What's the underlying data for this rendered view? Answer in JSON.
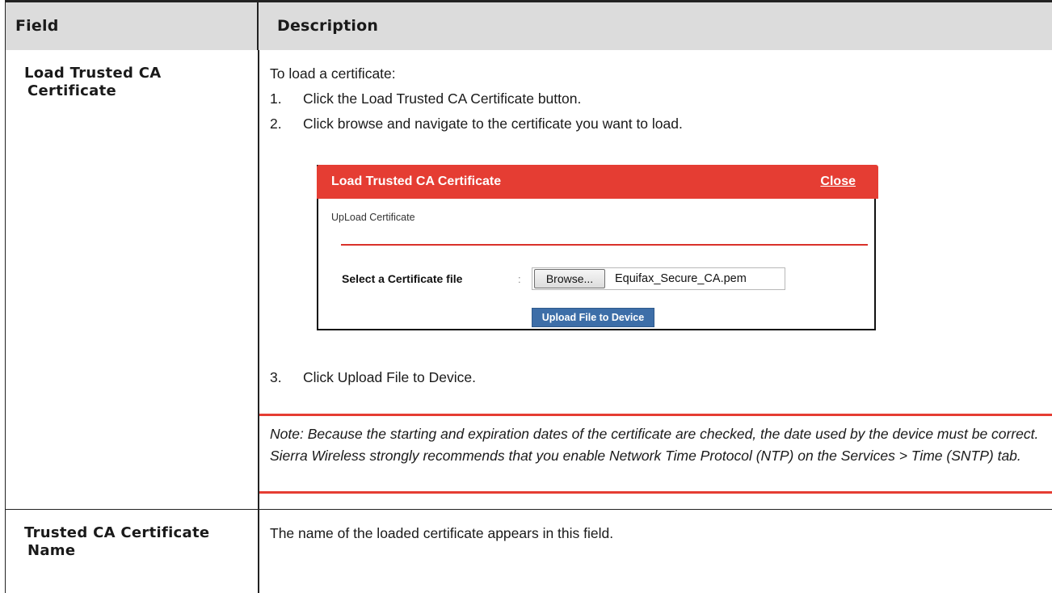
{
  "table": {
    "headers": {
      "field": "Field",
      "description": "Description"
    },
    "rows": [
      {
        "field_line1": "Load Trusted CA",
        "field_line2": "Certificate",
        "intro": "To load a certificate:",
        "steps": [
          {
            "num": "1.",
            "text": "Click the Load Trusted CA Certificate button."
          },
          {
            "num": "2.",
            "text": "Click browse and navigate to the certificate you want to load."
          },
          {
            "num": "3.",
            "text": "Click Upload File to Device."
          }
        ],
        "dialog": {
          "title": "Load Trusted CA Certificate",
          "close_label": "Close",
          "section_title": "UpLoad Certificate",
          "file_label": "Select a Certificate file",
          "colon": ":",
          "browse_label": "Browse...",
          "file_name": "Equifax_Secure_CA.pem",
          "upload_label": "Upload File to Device"
        },
        "note": "Note:  Because the starting and expiration dates of the certificate are checked, the date used by the device must be correct. Sierra Wireless strongly recommends that you enable Network Time Protocol (NTP) on the Services > Time (SNTP) tab."
      },
      {
        "field_line1": "Trusted CA Certificate",
        "field_line2": "Name",
        "description": "The name of the loaded certificate appears in this field."
      }
    ]
  },
  "colors": {
    "accent_red": "#e53d33",
    "upload_button_blue": "#3d6ea8",
    "header_gray": "#dcdcdc"
  }
}
